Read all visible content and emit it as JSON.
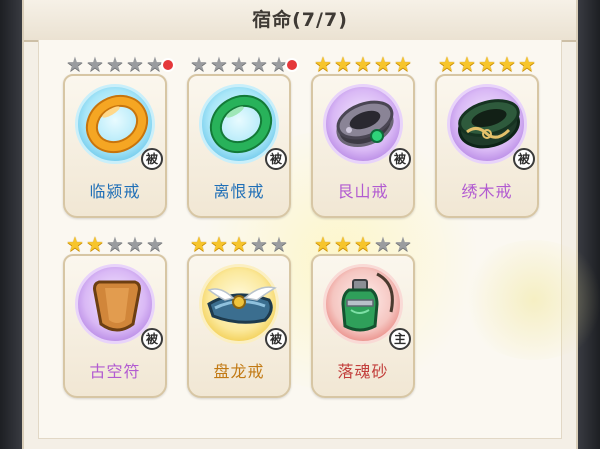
{
  "header": {
    "title": "宿命(7/7)"
  },
  "items": [
    {
      "name": "临颍戒",
      "stars_lit": 0,
      "stars_total": 5,
      "rarity": "blue",
      "tag": "被",
      "has_alert": true,
      "icon": "orange-ring-icon"
    },
    {
      "name": "离恨戒",
      "stars_lit": 0,
      "stars_total": 5,
      "rarity": "blue",
      "tag": "被",
      "has_alert": true,
      "icon": "green-ring-icon"
    },
    {
      "name": "艮山戒",
      "stars_lit": 5,
      "stars_total": 5,
      "rarity": "purple",
      "tag": "被",
      "has_alert": false,
      "icon": "jeweled-ring-icon"
    },
    {
      "name": "绣木戒",
      "stars_lit": 5,
      "stars_total": 5,
      "rarity": "purple",
      "tag": "被",
      "has_alert": false,
      "icon": "jade-band-icon"
    },
    {
      "name": "古空符",
      "stars_lit": 2,
      "stars_total": 5,
      "rarity": "purple",
      "tag": "被",
      "has_alert": false,
      "icon": "talisman-shield-icon"
    },
    {
      "name": "盘龙戒",
      "stars_lit": 3,
      "stars_total": 5,
      "rarity": "gold",
      "tag": "被",
      "has_alert": false,
      "icon": "winged-ring-icon"
    },
    {
      "name": "落魂砂",
      "stars_lit": 3,
      "stars_total": 5,
      "rarity": "red",
      "tag": "主",
      "has_alert": false,
      "icon": "sand-vial-icon"
    }
  ],
  "colors": {
    "star_on": "#f7c52b",
    "star_off": "#9a9c9f",
    "alert": "#e5383b",
    "name_blue": "#1f6fb7",
    "name_purple": "#b25bd1",
    "name_gold": "#c27a14",
    "name_red": "#c23f3c"
  }
}
